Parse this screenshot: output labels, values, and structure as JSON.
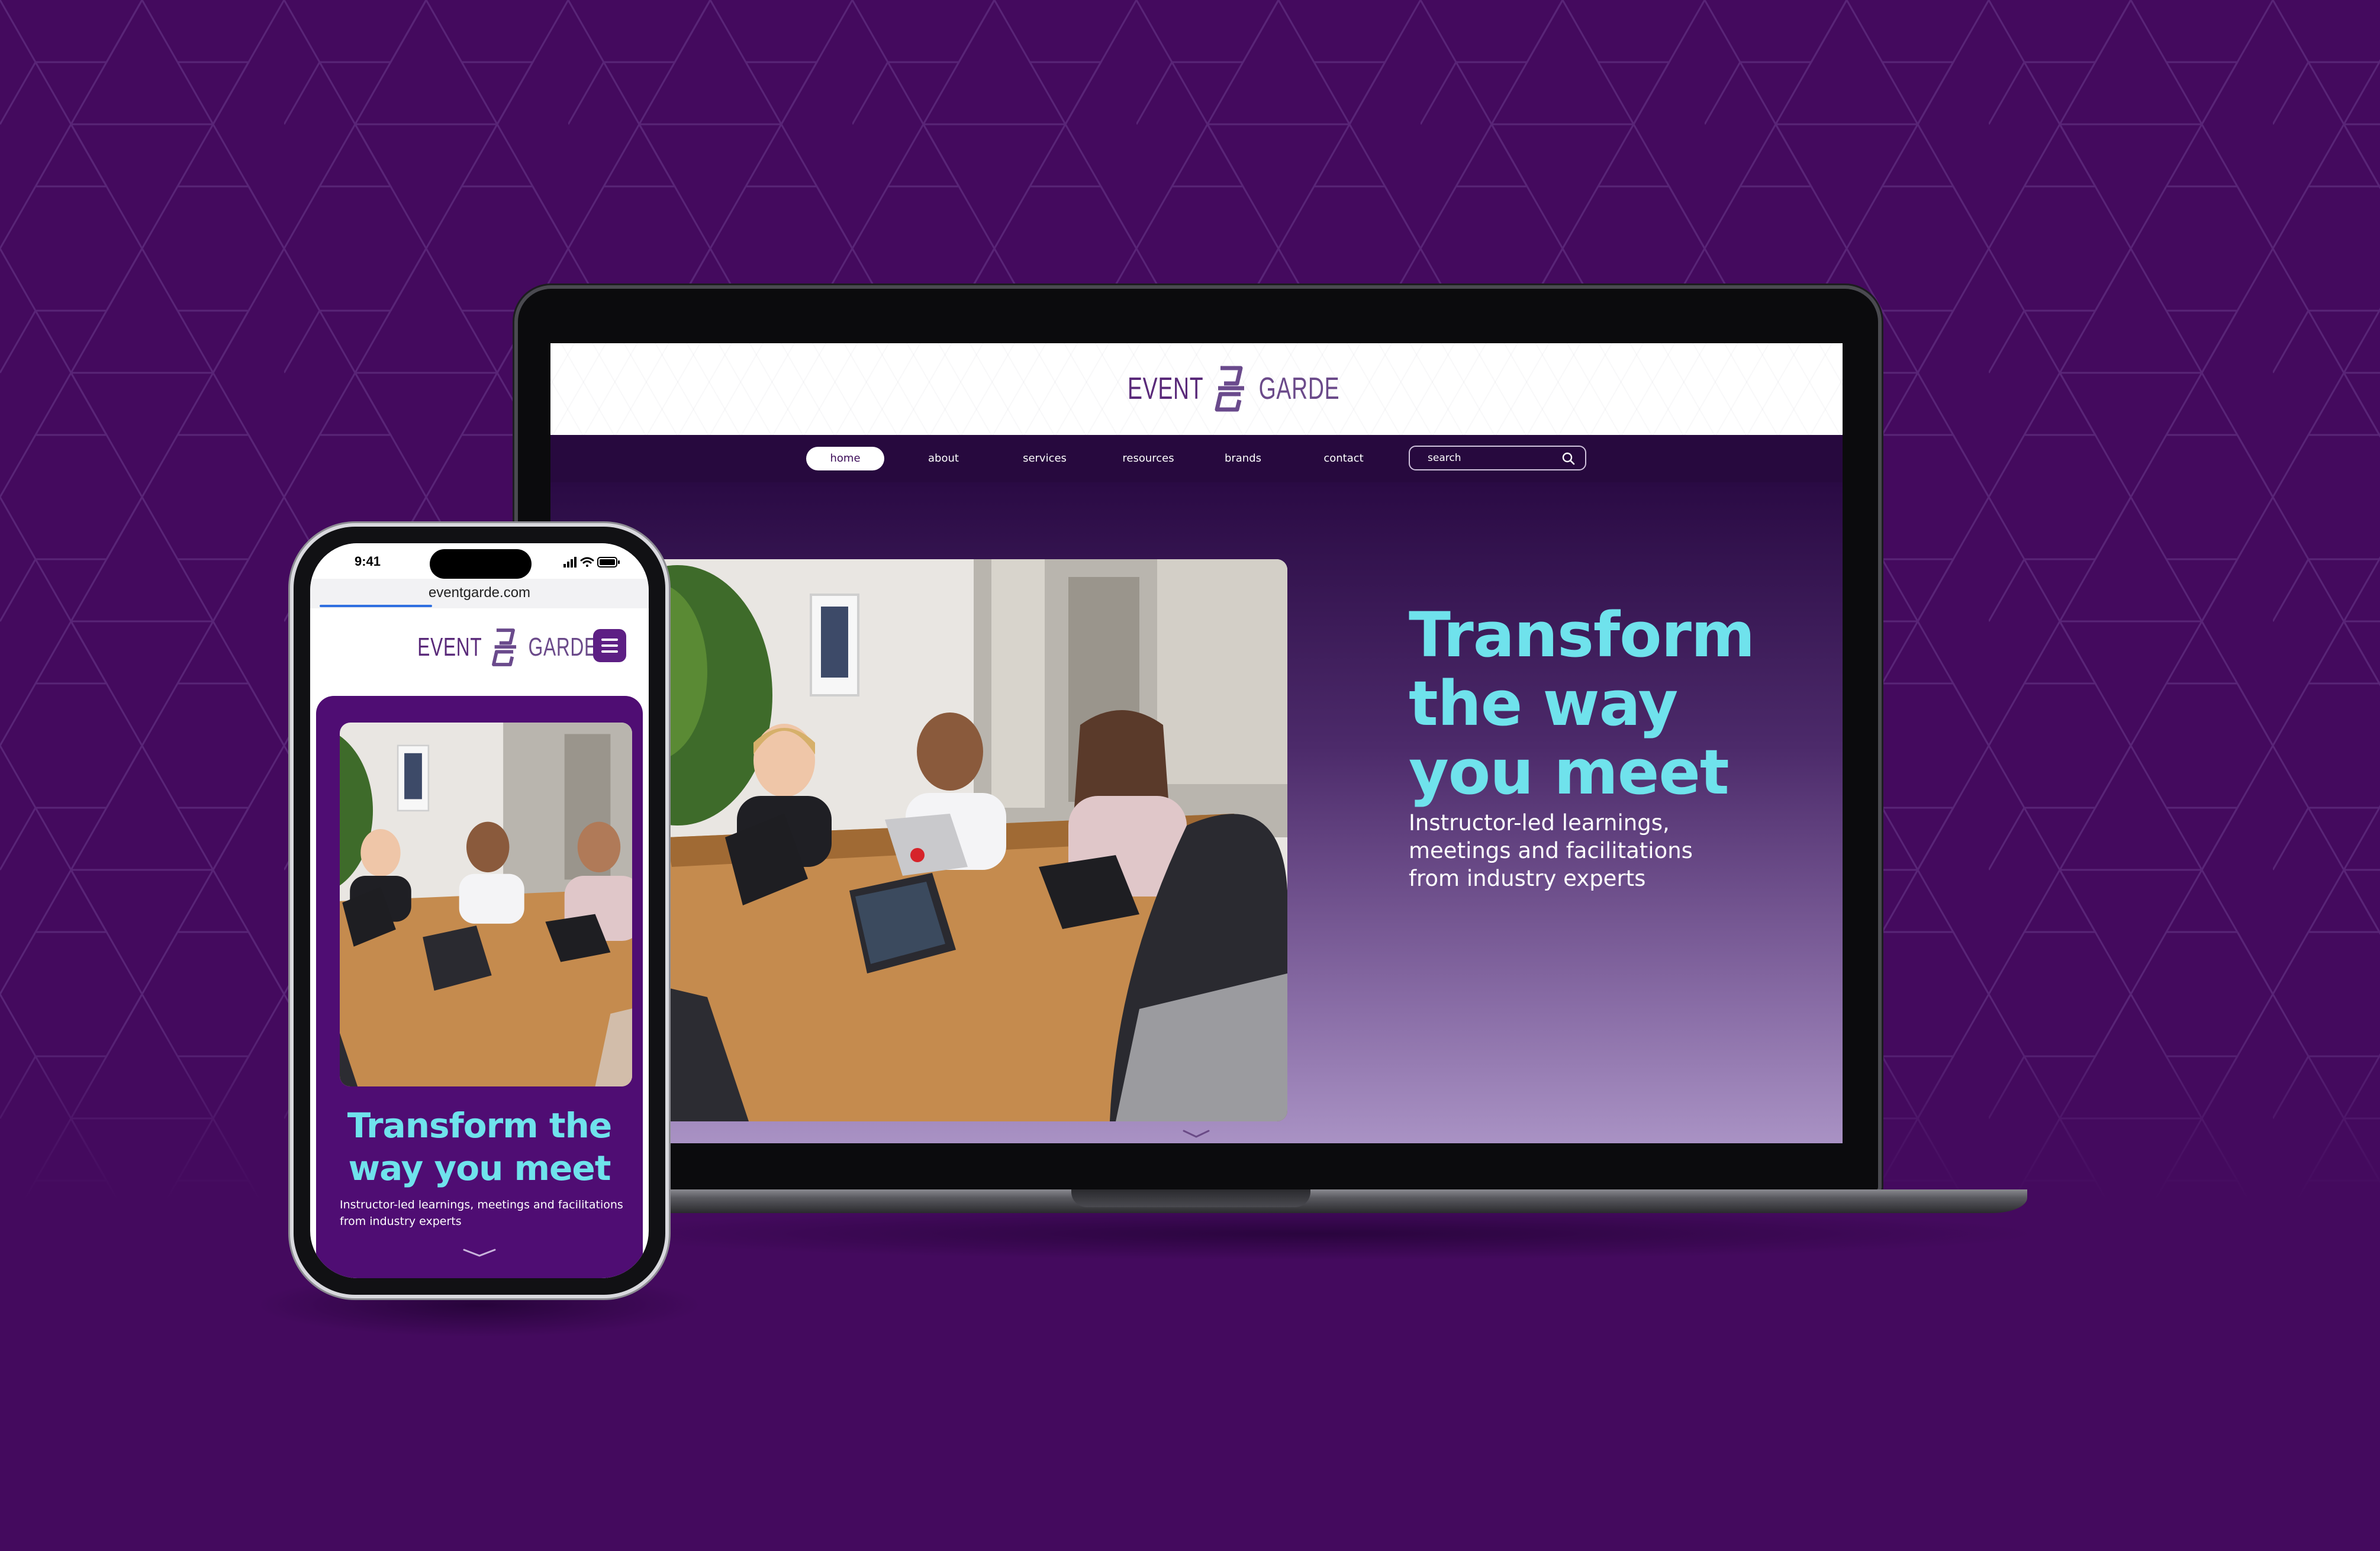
{
  "theme": {
    "background": "#440a5e",
    "accent_cyan": "#6fe2ec",
    "brand_purple": "#5d1f84"
  },
  "desktop": {
    "logo": {
      "left_word": "EVENT",
      "right_word": "GARDE",
      "mark": "eg-monogram-icon"
    },
    "nav": {
      "items": [
        {
          "label": "home",
          "active": true
        },
        {
          "label": "about",
          "active": false
        },
        {
          "label": "services",
          "active": false
        },
        {
          "label": "resources",
          "active": false
        },
        {
          "label": "brands",
          "active": false
        },
        {
          "label": "contact",
          "active": false
        }
      ],
      "search_placeholder": "search"
    },
    "hero": {
      "title_lines": [
        "Transform",
        "the way",
        "you meet"
      ],
      "subtitle_lines": [
        "Instructor-led learnings,",
        "meetings and facilitations",
        "from industry experts"
      ],
      "scroll_icon": "chevron-down-icon"
    }
  },
  "mobile": {
    "status_time": "9:41",
    "url": "eventgarde.com",
    "logo": {
      "left_word": "EVENT",
      "right_word": "GARDE"
    },
    "menu_icon": "hamburger-icon",
    "hero": {
      "title_lines": [
        "Transform the",
        "way you meet"
      ],
      "subtitle_lines": [
        "Instructor-led learnings, meetings and facilitations",
        "from industry experts"
      ],
      "scroll_icon": "chevron-down-icon"
    }
  }
}
